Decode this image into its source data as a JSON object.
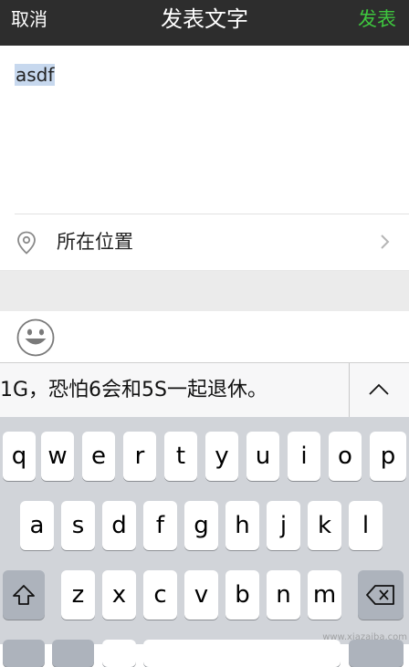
{
  "navbar": {
    "cancel_label": "取消",
    "title": "发表文字",
    "publish_label": "发表"
  },
  "compose": {
    "text": "asdf"
  },
  "location": {
    "label": "所在位置"
  },
  "suggestion": {
    "text": "1G，恐怕6会和5S一起退休。"
  },
  "keyboard": {
    "row1": [
      "q",
      "w",
      "e",
      "r",
      "t",
      "y",
      "u",
      "i",
      "o",
      "p"
    ],
    "row2": [
      "a",
      "s",
      "d",
      "f",
      "g",
      "h",
      "j",
      "k",
      "l"
    ],
    "row3": [
      "z",
      "x",
      "c",
      "v",
      "b",
      "n",
      "m"
    ]
  },
  "icons": {
    "location": "map-pin-icon",
    "chevron": "chevron-right-icon",
    "emoji": "smiley-face-icon",
    "collapse": "chevron-up-icon",
    "shift": "shift-icon",
    "delete": "backspace-icon"
  },
  "colors": {
    "navbar_bg": "#2d2d2d",
    "publish_green": "#3ec63e",
    "keyboard_bg": "#d1d4d9",
    "selection": "#c7d8ee"
  },
  "watermark": "www.xiazaiba.com"
}
